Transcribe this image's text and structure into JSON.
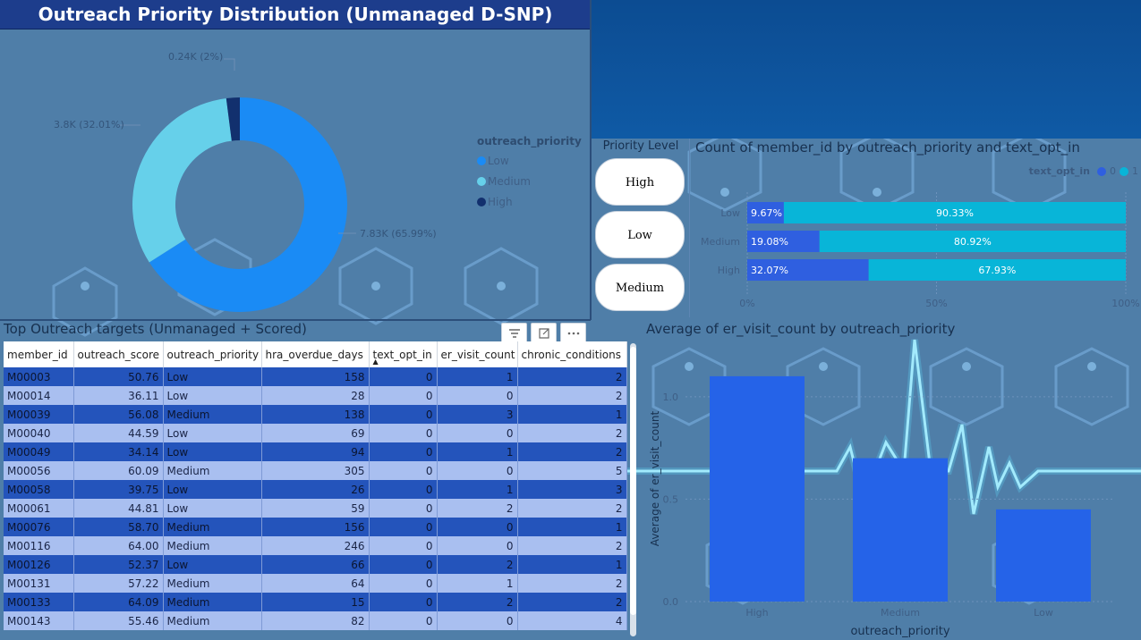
{
  "title": "Outreach Priority Distribution (Unmanaged D-SNP)",
  "donut": {
    "legend_title": "outreach_priority",
    "legend": [
      {
        "label": "Low",
        "color": "#1a8bf5"
      },
      {
        "label": "Medium",
        "color": "#66d0ea"
      },
      {
        "label": "High",
        "color": "#12306e"
      }
    ],
    "labels": {
      "high": "0.24K (2%)",
      "medium": "3.8K (32.01%)",
      "low": "7.83K (65.99%)"
    }
  },
  "chart_data": [
    {
      "type": "pie",
      "categories": [
        "Low",
        "Medium",
        "High"
      ],
      "values": [
        7830,
        3800,
        240
      ],
      "percentages": [
        65.99,
        32.01,
        2
      ],
      "title": "Outreach Priority Distribution (Unmanaged D-SNP)",
      "legend_title": "outreach_priority",
      "legend_position": "right"
    },
    {
      "type": "bar",
      "orientation": "horizontal-stacked-100",
      "title": "Count of member_id by outreach_priority and text_opt_in",
      "categories": [
        "Low",
        "Medium",
        "High"
      ],
      "series": [
        {
          "name": "0",
          "values": [
            9.67,
            19.08,
            32.07
          ],
          "color": "#2f5fe0"
        },
        {
          "name": "1",
          "values": [
            90.33,
            80.92,
            67.93
          ],
          "color": "#08b5d8"
        }
      ],
      "legend_title": "text_opt_in",
      "xticks": [
        "0%",
        "50%",
        "100%"
      ],
      "legend_position": "top-right"
    },
    {
      "type": "bar",
      "title": "Average of er_visit_count by outreach_priority",
      "categories": [
        "High",
        "Medium",
        "Low"
      ],
      "values": [
        1.1,
        0.7,
        0.45
      ],
      "xlabel": "outreach_priority",
      "ylabel": "Average of er_visit_count",
      "yticks": [
        "0.0",
        "0.5",
        "1.0"
      ],
      "ylim": [
        0,
        1.2
      ],
      "color": "#2563e8"
    }
  ],
  "slicer": {
    "title": "Priority Level",
    "items": [
      "High",
      "Low",
      "Medium"
    ]
  },
  "stacked": {
    "title": "Count of member_id by outreach_priority and text_opt_in",
    "legend_title": "text_opt_in",
    "legend_items": [
      "0",
      "1"
    ]
  },
  "table": {
    "title": "Top Outreach targets (Unmanaged + Scored)",
    "columns": [
      "member_id",
      "outreach_score",
      "outreach_priority",
      "hra_overdue_days",
      "text_opt_in",
      "er_visit_count",
      "chronic_conditions"
    ],
    "rows": [
      [
        "M00003",
        "50.76",
        "Low",
        "158",
        "0",
        "1",
        "2"
      ],
      [
        "M00014",
        "36.11",
        "Low",
        "28",
        "0",
        "0",
        "2"
      ],
      [
        "M00039",
        "56.08",
        "Medium",
        "138",
        "0",
        "3",
        "1"
      ],
      [
        "M00040",
        "44.59",
        "Low",
        "69",
        "0",
        "0",
        "2"
      ],
      [
        "M00049",
        "34.14",
        "Low",
        "94",
        "0",
        "1",
        "2"
      ],
      [
        "M00056",
        "60.09",
        "Medium",
        "305",
        "0",
        "0",
        "5"
      ],
      [
        "M00058",
        "39.75",
        "Low",
        "26",
        "0",
        "1",
        "3"
      ],
      [
        "M00061",
        "44.81",
        "Low",
        "59",
        "0",
        "2",
        "2"
      ],
      [
        "M00076",
        "58.70",
        "Medium",
        "156",
        "0",
        "0",
        "1"
      ],
      [
        "M00116",
        "64.00",
        "Medium",
        "246",
        "0",
        "0",
        "2"
      ],
      [
        "M00126",
        "52.37",
        "Low",
        "66",
        "0",
        "2",
        "1"
      ],
      [
        "M00131",
        "57.22",
        "Medium",
        "64",
        "0",
        "1",
        "2"
      ],
      [
        "M00133",
        "64.09",
        "Medium",
        "15",
        "0",
        "2",
        "2"
      ],
      [
        "M00143",
        "55.46",
        "Medium",
        "82",
        "0",
        "0",
        "4"
      ]
    ],
    "toolbar_icons": [
      "filter-icon",
      "focus-mode-icon",
      "more-options-icon"
    ]
  },
  "colors": {
    "title_bg": "#1d3d8c",
    "table_dark_row": "#2454bb",
    "table_light_row": "#a9bff0",
    "bar": "#2563e8"
  }
}
